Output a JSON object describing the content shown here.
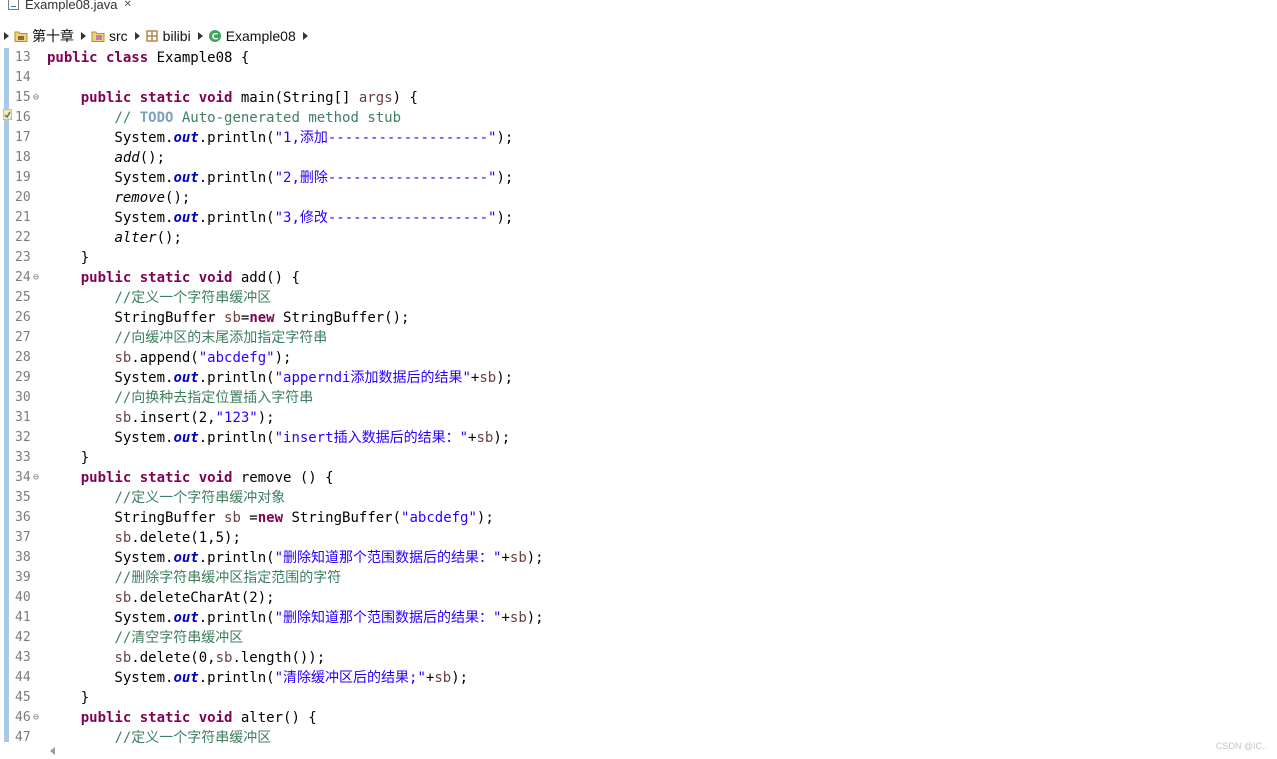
{
  "tab": {
    "title": "Example08.java",
    "close": "✕"
  },
  "breadcrumb": [
    {
      "label": "第十章",
      "icon": "package-folder-icon"
    },
    {
      "label": "src",
      "icon": "source-folder-icon"
    },
    {
      "label": "bilibi",
      "icon": "package-icon"
    },
    {
      "label": "Example08",
      "icon": "class-icon"
    }
  ],
  "lines": [
    {
      "n": "13",
      "fold": "",
      "t": "<span class='k'>public class</span> Example08 {"
    },
    {
      "n": "14",
      "fold": "",
      "t": ""
    },
    {
      "n": "15",
      "fold": "⊖",
      "t": "    <span class='k'>public static void</span> main(String[] <span class='v'>args</span>) {"
    },
    {
      "n": "16",
      "fold": "",
      "t": "        <span class='c'>// </span><span class='ck'>TODO</span><span class='c'> Auto-generated method stub</span>"
    },
    {
      "n": "17",
      "fold": "",
      "t": "        System.<span class='f'>out</span>.println(<span class='s'>\"1,添加-------------------\"</span>);"
    },
    {
      "n": "18",
      "fold": "",
      "t": "        <span class='i'>add</span>();"
    },
    {
      "n": "19",
      "fold": "",
      "t": "        System.<span class='f'>out</span>.println(<span class='s'>\"2,删除-------------------\"</span>);"
    },
    {
      "n": "20",
      "fold": "",
      "t": "        <span class='i'>remove</span>();"
    },
    {
      "n": "21",
      "fold": "",
      "t": "        System.<span class='f'>out</span>.println(<span class='s'>\"3,修改-------------------\"</span>);"
    },
    {
      "n": "22",
      "fold": "",
      "t": "        <span class='i'>alter</span>();"
    },
    {
      "n": "23",
      "fold": "",
      "t": "    }"
    },
    {
      "n": "24",
      "fold": "⊖",
      "t": "    <span class='k'>public static void</span> add() {"
    },
    {
      "n": "25",
      "fold": "",
      "t": "        <span class='c'>//定义一个字符串缓冲区</span>"
    },
    {
      "n": "26",
      "fold": "",
      "t": "        StringBuffer <span class='v'>sb</span>=<span class='k'>new</span> StringBuffer();"
    },
    {
      "n": "27",
      "fold": "",
      "t": "        <span class='c'>//向缓冲区的末尾添加指定字符串</span>"
    },
    {
      "n": "28",
      "fold": "",
      "t": "        <span class='v'>sb</span>.append(<span class='s'>\"abcdefg\"</span>);"
    },
    {
      "n": "29",
      "fold": "",
      "t": "        System.<span class='f'>out</span>.println(<span class='s'>\"apperndi添加数据后的结果\"</span>+<span class='v'>sb</span>);"
    },
    {
      "n": "30",
      "fold": "",
      "t": "        <span class='c'>//向换种去指定位置插入字符串</span>"
    },
    {
      "n": "31",
      "fold": "",
      "t": "        <span class='v'>sb</span>.insert(2,<span class='s'>\"123\"</span>);"
    },
    {
      "n": "32",
      "fold": "",
      "t": "        System.<span class='f'>out</span>.println(<span class='s'>\"insert插入数据后的结果：\"</span>+<span class='v'>sb</span>);"
    },
    {
      "n": "33",
      "fold": "",
      "t": "    }"
    },
    {
      "n": "34",
      "fold": "⊖",
      "t": "    <span class='k'>public static void</span> remove () {"
    },
    {
      "n": "35",
      "fold": "",
      "t": "        <span class='c'>//定义一个字符串缓冲对象</span>"
    },
    {
      "n": "36",
      "fold": "",
      "t": "        StringBuffer <span class='v'>sb</span> =<span class='k'>new</span> StringBuffer(<span class='s'>\"abcdefg\"</span>);"
    },
    {
      "n": "37",
      "fold": "",
      "t": "        <span class='v'>sb</span>.delete(1,5);"
    },
    {
      "n": "38",
      "fold": "",
      "t": "        System.<span class='f'>out</span>.println(<span class='s'>\"删除知道那个范围数据后的结果：\"</span>+<span class='v'>sb</span>);"
    },
    {
      "n": "39",
      "fold": "",
      "t": "        <span class='c'>//删除字符串缓冲区指定范围的字符</span>"
    },
    {
      "n": "40",
      "fold": "",
      "t": "        <span class='v'>sb</span>.deleteCharAt(2);"
    },
    {
      "n": "41",
      "fold": "",
      "t": "        System.<span class='f'>out</span>.println(<span class='s'>\"删除知道那个范围数据后的结果：\"</span>+<span class='v'>sb</span>);"
    },
    {
      "n": "42",
      "fold": "",
      "t": "        <span class='c'>//清空字符串缓冲区</span>"
    },
    {
      "n": "43",
      "fold": "",
      "t": "        <span class='v'>sb</span>.delete(0,<span class='v'>sb</span>.length());"
    },
    {
      "n": "44",
      "fold": "",
      "t": "        System.<span class='f'>out</span>.println(<span class='s'>\"清除缓冲区后的结果;\"</span>+<span class='v'>sb</span>);"
    },
    {
      "n": "45",
      "fold": "",
      "t": "    }"
    },
    {
      "n": "46",
      "fold": "⊖",
      "t": "    <span class='k'>public static void</span> alter() {"
    },
    {
      "n": "47",
      "fold": "",
      "t": "        <span class='c'>//定义一个字符串缓冲区</span>"
    }
  ],
  "watermark": "CSDN @IC.."
}
